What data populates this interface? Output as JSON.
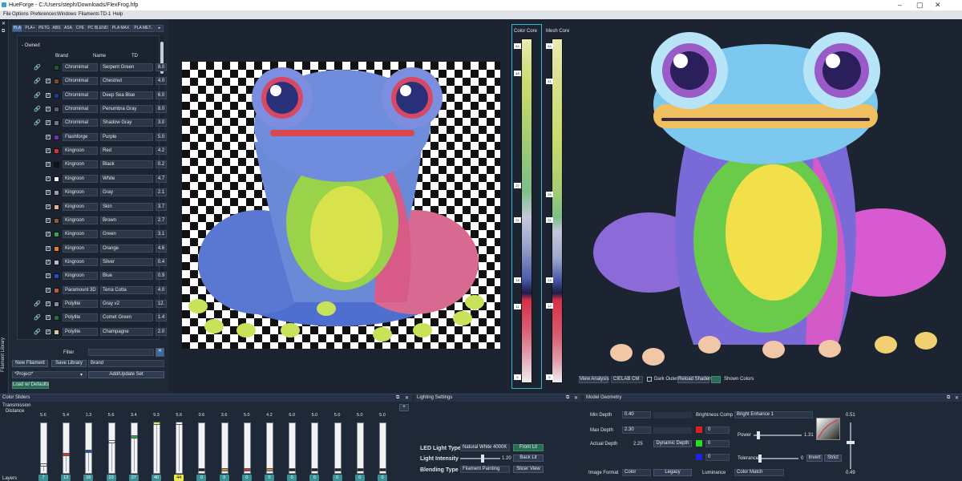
{
  "window": {
    "title": "HueForge - C:/Users/steph/Downloads/FlexFrog.hfp",
    "min": "–",
    "max": "▢",
    "close": "✕"
  },
  "menu": [
    "File",
    "Options",
    "Preferences",
    "Windows",
    "Filaments",
    "TD-1",
    "Help"
  ],
  "sidebar": {
    "label": "Filament Library"
  },
  "filament_tabs": [
    "PLA",
    "PLA+",
    "PETG",
    "ABS",
    "ASA",
    "CPE",
    "PC BLEND",
    "PLA MAX",
    "PLA MET.."
  ],
  "owned_label": "- Owned",
  "columns": {
    "brand": "Brand",
    "name": "Name",
    "td": "TD"
  },
  "filaments": [
    {
      "brand": "Chromimal",
      "name": "Serpent Green",
      "td": "8.0",
      "color": "#1f5a2e",
      "link": true,
      "checked": false
    },
    {
      "brand": "Chromimal",
      "name": "Chestnut",
      "td": "4.0",
      "color": "#7a4b2e",
      "link": true,
      "checked": true
    },
    {
      "brand": "Chromimal",
      "name": "Deep Sea Blue",
      "td": "6.0",
      "color": "#1f3c8c",
      "link": true,
      "checked": true
    },
    {
      "brand": "Chromimal",
      "name": "Penumbra Gray",
      "td": "8.0",
      "color": "#5b5f66",
      "link": true,
      "checked": true
    },
    {
      "brand": "Chromimal",
      "name": "Shadow Gray",
      "td": "3.0",
      "color": "#72767c",
      "link": true,
      "checked": true
    },
    {
      "brand": "Flashforge",
      "name": "Purple",
      "td": "5.0",
      "color": "#7a2fb4",
      "link": false,
      "checked": true
    },
    {
      "brand": "Kingroon",
      "name": "Red",
      "td": "4.2",
      "color": "#d8322f",
      "link": false,
      "checked": true
    },
    {
      "brand": "Kingroon",
      "name": "Black",
      "td": "0.2",
      "color": "#111111",
      "link": false,
      "checked": true
    },
    {
      "brand": "Kingroon",
      "name": "White",
      "td": "4.7",
      "color": "#f4f4f4",
      "link": false,
      "checked": true
    },
    {
      "brand": "Kingroon",
      "name": "Gray",
      "td": "2.1",
      "color": "#9a9da3",
      "link": false,
      "checked": true
    },
    {
      "brand": "Kingroon",
      "name": "Skin",
      "td": "3.7",
      "color": "#e8b28c",
      "link": false,
      "checked": true
    },
    {
      "brand": "Kingroon",
      "name": "Brown",
      "td": "2.7",
      "color": "#8a5a34",
      "link": false,
      "checked": true
    },
    {
      "brand": "Kingroon",
      "name": "Green",
      "td": "3.1",
      "color": "#2fa84a",
      "link": false,
      "checked": true
    },
    {
      "brand": "Kingroon",
      "name": "Orange",
      "td": "4.6",
      "color": "#f07a22",
      "link": false,
      "checked": true
    },
    {
      "brand": "Kingroon",
      "name": "Silver",
      "td": "0.4",
      "color": "#b9bec4",
      "link": false,
      "checked": true
    },
    {
      "brand": "Kingroon",
      "name": "Blue",
      "td": "0.9",
      "color": "#1e4fc4",
      "link": false,
      "checked": true
    },
    {
      "brand": "Paramount 3D",
      "name": "Terra Cotta",
      "td": "4.0",
      "color": "#b85b3a",
      "link": false,
      "checked": true
    },
    {
      "brand": "Polylite",
      "name": "Gray v2",
      "td": "12.",
      "color": "#8a8d92",
      "link": true,
      "checked": true
    },
    {
      "brand": "Polylite",
      "name": "Comet Green",
      "td": "1.4",
      "color": "#2d6e3e",
      "link": true,
      "checked": true
    },
    {
      "brand": "Polylite",
      "name": "Champagne",
      "td": "2.0",
      "color": "#d8c8a0",
      "link": true,
      "checked": true
    }
  ],
  "filter": {
    "label": "Filter",
    "value": ""
  },
  "buttons": {
    "new_filament": "New Filament",
    "save_library": "Save Library",
    "brand_value": "Brand",
    "project_value": "*Project*",
    "add_update": "Add/Update Set",
    "load_defaults": "Load w/ Defaults"
  },
  "core": {
    "color_core": "Color Core",
    "mesh_core": "Mesh Core",
    "color_markers": [
      "64",
      "48",
      "27",
      "21",
      "14",
      "11",
      "5"
    ],
    "mesh_markers": [
      "64",
      "41",
      "26",
      "21",
      "13",
      "12",
      "5"
    ]
  },
  "view_controls": {
    "view_analysis": "View Analysis",
    "space": "CIELAB CM",
    "dark_outer": "Dark Outer",
    "reload": "Reload Shaders",
    "show_colors": "Shown Colors"
  },
  "color_sliders": {
    "title": "Color Sliders",
    "label1": "Transmission",
    "label2": "Distance",
    "label3": "Layers",
    "top_values": [
      "5.6",
      "5.4",
      "1.3",
      "5.6",
      "3.4",
      "9.3",
      "5.6",
      "0.6",
      "3.6",
      "5.0",
      "4.2",
      "6.0",
      "5.0",
      "5.0",
      "5.0",
      "5.0"
    ],
    "bottom_values": [
      "7",
      "13",
      "16",
      "23",
      "27",
      "40",
      "44",
      "0",
      "0",
      "0",
      "0",
      "0",
      "0",
      "0",
      "0",
      "0"
    ],
    "levels": [
      0.1,
      0.33,
      0.4,
      0.6,
      0.7,
      1.0,
      1.0,
      0,
      0,
      0,
      0,
      0,
      0,
      0,
      0,
      0
    ],
    "knob_colors": [
      "#f4f4f4",
      "#d8322f",
      "#1e4fc4",
      "#f4f4f4",
      "#2fa84a",
      "#e6e64a",
      "#f4f4f4",
      "#222222",
      "#d28a32",
      "#d8322f",
      "#d28a32",
      "#222222",
      "#222222",
      "#222222",
      "#222222",
      "#222222"
    ]
  },
  "lighting": {
    "title": "Lighting Settings",
    "led_type_label": "LED Light Type",
    "led_type": "Natural White 4000K",
    "front_lit": "Front Lit",
    "intensity_label": "Light Intensity",
    "intensity": "1.20",
    "intensity_level": 0.55,
    "back_lit": "Back Lit",
    "blending_label": "Blending Type",
    "blending": "Filament Painting",
    "slicer_view": "Slicer View"
  },
  "model": {
    "title": "Model Geometry",
    "min_depth_label": "Min Depth",
    "min_depth": "0.40",
    "max_depth_label": "Max Depth",
    "max_depth": "2.30",
    "actual_depth_label": "Actual Depth",
    "actual_depth": "2.25",
    "dynamic_depth": "Dynamic Depth",
    "brightness_label": "Brightness Comp",
    "brightness": "Bright Enhance 1",
    "power_label": "Power",
    "power": "1.31",
    "tolerance_label": "Tolerance",
    "tolerance": "0",
    "invert": "Invert",
    "strict": "Strict",
    "image_format_label": "Image Format",
    "image_format": "Color",
    "legacy": "Legacy",
    "luminance_label": "Luminance",
    "luminance": "Color Match",
    "rgb": [
      "0",
      "0",
      "0"
    ],
    "val_top": "0.51",
    "val_bottom": "0.49"
  }
}
